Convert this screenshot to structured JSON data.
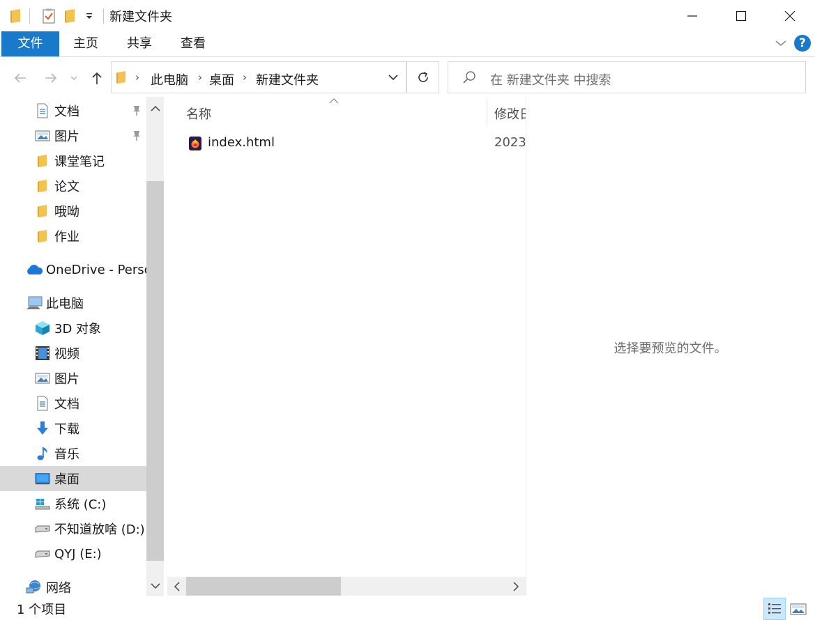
{
  "window": {
    "title": "新建文件夹"
  },
  "ribbon": {
    "tabs": [
      "文件",
      "主页",
      "共享",
      "查看"
    ]
  },
  "address": {
    "parts": [
      "此电脑",
      "桌面",
      "新建文件夹"
    ]
  },
  "search": {
    "placeholder": "在 新建文件夹 中搜索"
  },
  "nav": {
    "quick_access": [
      {
        "label": "文档",
        "icon": "document-icon",
        "pinned": true
      },
      {
        "label": "图片",
        "icon": "picture-icon",
        "pinned": true
      },
      {
        "label": "课堂笔记",
        "icon": "folder-icon",
        "pinned": false
      },
      {
        "label": "论文",
        "icon": "folder-icon",
        "pinned": false
      },
      {
        "label": "哦呦",
        "icon": "folder-icon",
        "pinned": false
      },
      {
        "label": "作业",
        "icon": "folder-icon",
        "pinned": false
      }
    ],
    "onedrive": "OneDrive - Perso",
    "this_pc": "此电脑",
    "pc_items": [
      {
        "label": "3D 对象",
        "icon": "cube-icon"
      },
      {
        "label": "视频",
        "icon": "video-icon"
      },
      {
        "label": "图片",
        "icon": "picture-icon"
      },
      {
        "label": "文档",
        "icon": "document-icon"
      },
      {
        "label": "下载",
        "icon": "download-icon"
      },
      {
        "label": "音乐",
        "icon": "music-icon"
      },
      {
        "label": "桌面",
        "icon": "desktop-icon",
        "selected": true
      },
      {
        "label": "系统 (C:)",
        "icon": "system-drive-icon"
      },
      {
        "label": "不知道放啥 (D:)",
        "icon": "drive-icon"
      },
      {
        "label": "QYJ (E:)",
        "icon": "drive-icon"
      }
    ],
    "network": "网络"
  },
  "files": {
    "columns": {
      "name": "名称",
      "date": "修改日期"
    },
    "rows": [
      {
        "name": "index.html",
        "date": "2023"
      }
    ]
  },
  "preview": {
    "message": "选择要预览的文件。"
  },
  "status": {
    "count": "1 个项目"
  },
  "colors": {
    "accent": "#1979ca",
    "selection": "#d9d9d9",
    "folder": "#f3c24f"
  }
}
